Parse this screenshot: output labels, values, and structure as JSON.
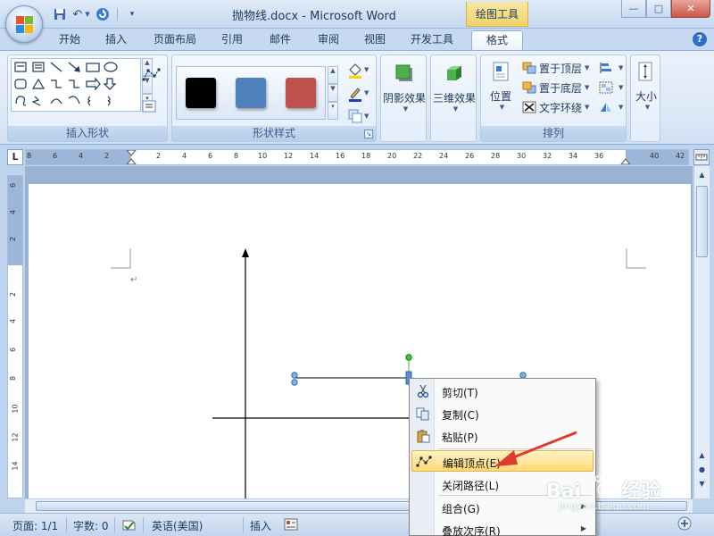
{
  "window": {
    "title": "抛物线.docx - Microsoft Word",
    "context_tool": "绘图工具"
  },
  "tabs": [
    "开始",
    "插入",
    "页面布局",
    "引用",
    "邮件",
    "审阅",
    "视图",
    "开发工具",
    "格式"
  ],
  "active_tab": "格式",
  "ribbon": {
    "groups": {
      "insert_shapes": "插入形状",
      "shape_styles": "形状样式",
      "shadow": "阴影效果",
      "3d": "三维效果",
      "arrange": "排列",
      "size": "大小"
    },
    "style_swatch_colors": [
      "#000000",
      "#4f81bd",
      "#c0504d"
    ],
    "arrange": {
      "position": "位置",
      "bring_front": "置于顶层",
      "send_back": "置于底层",
      "text_wrap": "文字环绕"
    }
  },
  "hruler_numbers": [
    "8",
    "6",
    "4",
    "2",
    "2",
    "4",
    "6",
    "8",
    "10",
    "12",
    "14",
    "16",
    "18",
    "20",
    "22",
    "24",
    "26",
    "28",
    "30",
    "32",
    "34",
    "36",
    "40",
    "42"
  ],
  "vruler_numbers": [
    "6",
    "4",
    "2",
    "2",
    "4",
    "6",
    "8",
    "10",
    "12",
    "14"
  ],
  "status": {
    "page": "页面: 1/1",
    "words": "字数: 0",
    "language": "英语(美国)",
    "mode": "插入"
  },
  "context_menu": {
    "items": [
      {
        "label": "剪切(T)",
        "icon": "scissors-icon"
      },
      {
        "label": "复制(C)",
        "icon": "copy-icon"
      },
      {
        "label": "粘贴(P)",
        "icon": "paste-icon"
      },
      {
        "label": "编辑顶点(E)",
        "icon": "edit-points-icon",
        "highlighted": true
      },
      {
        "label": "关闭路径(L)",
        "icon": ""
      },
      {
        "label": "组合(G)",
        "icon": "",
        "submenu": true
      },
      {
        "label": "叠放次序(R)",
        "icon": "",
        "submenu": true
      }
    ]
  },
  "watermark": {
    "brand": "Bai",
    "brand_suffix": "经验",
    "url": "jingyan.baidu.com"
  }
}
